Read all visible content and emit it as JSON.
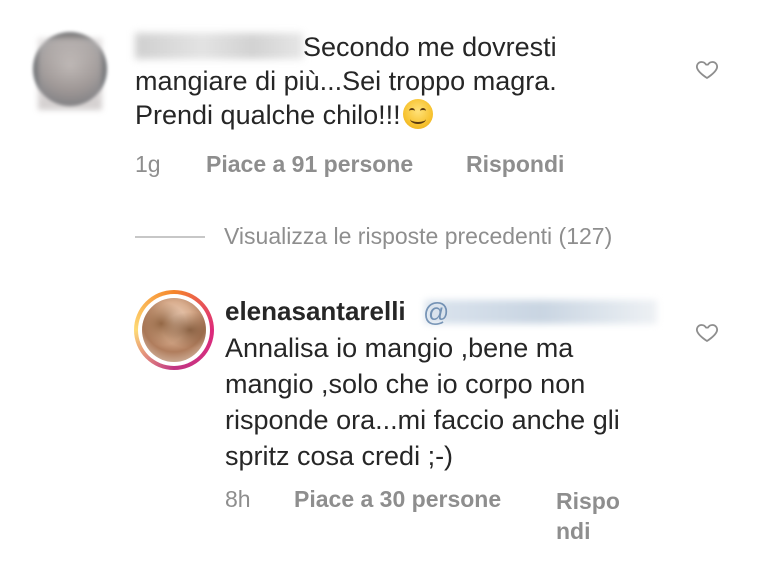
{
  "comments": [
    {
      "text_lines": [
        "Secondo me dovresti",
        "mangiare di più...Sei troppo magra.",
        "Prendi qualche chilo!!!"
      ],
      "emoji": "smiling-face",
      "time": "1g",
      "likes": "Piace a 91 persone",
      "reply_label": "Rispondi"
    }
  ],
  "view_previous_replies": "Visualizza le risposte precedenti (127)",
  "reply": {
    "username": "elenasantarelli",
    "mention_prefix": "@",
    "text_lines": [
      "Annalisa io mangio ,bene ma",
      "mangio ,solo che io corpo non",
      "risponde ora...mi faccio anche gli",
      "spritz cosa credi ;-)"
    ],
    "time": "8h",
    "likes": "Piace a 30 persone",
    "reply_label_lines": [
      "Rispo",
      "ndi"
    ]
  },
  "colors": {
    "text": "#262626",
    "meta": "#8e8e8e",
    "ring_start": "#f58529",
    "ring_end": "#dd2a7b"
  }
}
